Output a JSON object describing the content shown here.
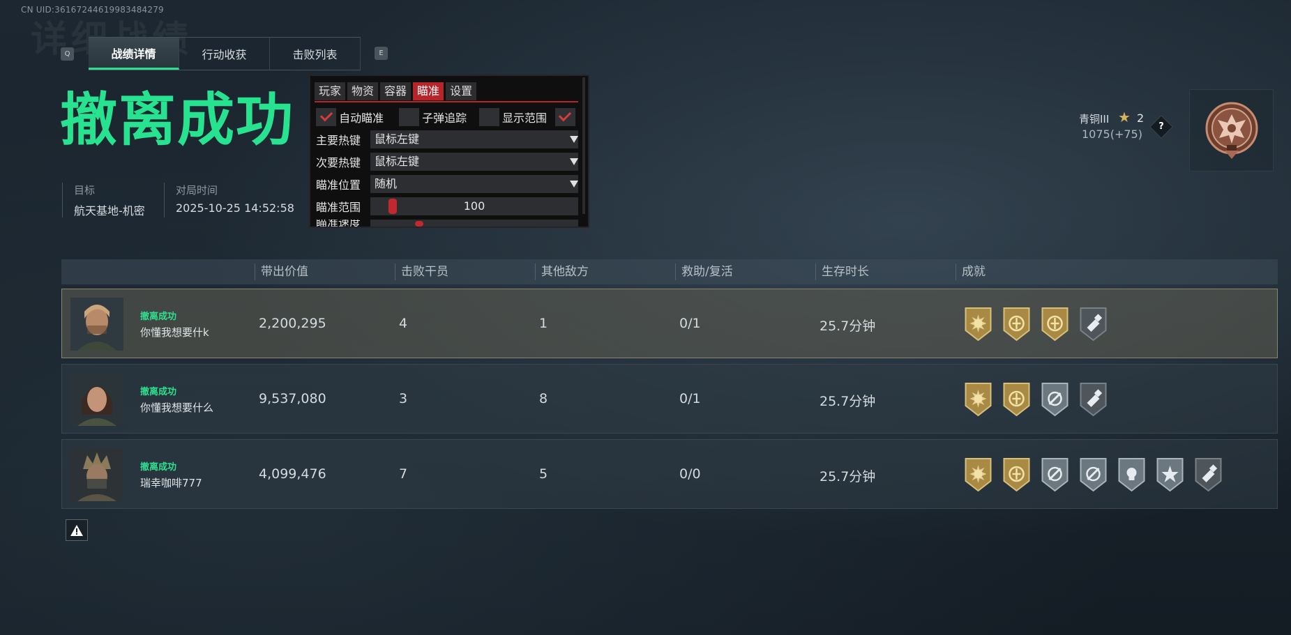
{
  "uid_text": "CN UID:3616724461998348427​9",
  "background_title": "详细战绩",
  "keys": {
    "prev": "Q",
    "next": "E"
  },
  "tabs": [
    {
      "label": "战绩详情",
      "active": true
    },
    {
      "label": "行动收获",
      "active": false
    },
    {
      "label": "击败列表",
      "active": false
    }
  ],
  "headline": "撤离成功",
  "info": {
    "target_label": "目标",
    "target_value": "航天基地-机密",
    "time_label": "对局时间",
    "time_value": "2025-10-25 14:52:58"
  },
  "overlay": {
    "tabs": [
      {
        "label": "玩家",
        "active": false
      },
      {
        "label": "物资",
        "active": false
      },
      {
        "label": "容器",
        "active": false
      },
      {
        "label": "瞄准",
        "active": true
      },
      {
        "label": "设置",
        "active": false
      }
    ],
    "checkboxes": [
      {
        "label": "自动瞄准",
        "checked": true
      },
      {
        "label": "子弹追踪",
        "checked": false
      },
      {
        "label": "显示范围",
        "checked": false
      },
      {
        "label": "",
        "checked": true
      }
    ],
    "primary_hotkey_label": "主要热键",
    "primary_hotkey_value": "鼠标左键",
    "secondary_hotkey_label": "次要热键",
    "secondary_hotkey_value": "鼠标左键",
    "aim_position_label": "瞄准位置",
    "aim_position_value": "随机",
    "aim_range_label": "瞄准范围",
    "aim_range_value": "100",
    "aim_speed_label": "瞄准速度"
  },
  "rank": {
    "name": "青铜III",
    "stars": "2",
    "score": "1075(+75)",
    "help": "?"
  },
  "table": {
    "headers": [
      "带出价值",
      "击败干员",
      "其他敌方",
      "救助/复活",
      "生存时长",
      "成就"
    ],
    "rows": [
      {
        "status": "撤离成功",
        "name": "你懂我想要什k",
        "value": "2,200,295",
        "kills": "4",
        "other": "1",
        "assist": "0/1",
        "time": "25.7分钟",
        "medals": [
          "gold-sun-medal-icon",
          "gold-emblem-medal-icon",
          "gold-crest-medal-icon",
          "gray-hammer-medal-icon"
        ]
      },
      {
        "status": "撤离成功",
        "name": "你懂我想要什么",
        "value": "9,537,080",
        "kills": "3",
        "other": "8",
        "assist": "0/1",
        "time": "25.7分钟",
        "medals": [
          "gold-sun-medal-icon",
          "gold-crest-medal-icon",
          "silver-crosshair-medal-icon",
          "gray-hammer-medal-icon"
        ]
      },
      {
        "status": "撤离成功",
        "name": "瑞幸咖啡777",
        "value": "4,099,476",
        "kills": "7",
        "other": "5",
        "assist": "0/0",
        "time": "25.7分钟",
        "medals": [
          "gold-sun-medal-icon",
          "gold-crest-medal-icon",
          "silver-crosshair-medal-icon",
          "silver-crosshair-medal-icon",
          "silver-skull-medal-icon",
          "silver-star-medal-icon",
          "gray-hammer-medal-icon"
        ]
      }
    ]
  },
  "colors": {
    "accent_green": "#27e38f",
    "overlay_red": "#b5262b",
    "medal_gold": "#a88a45",
    "medal_silver": "#6c7880"
  }
}
